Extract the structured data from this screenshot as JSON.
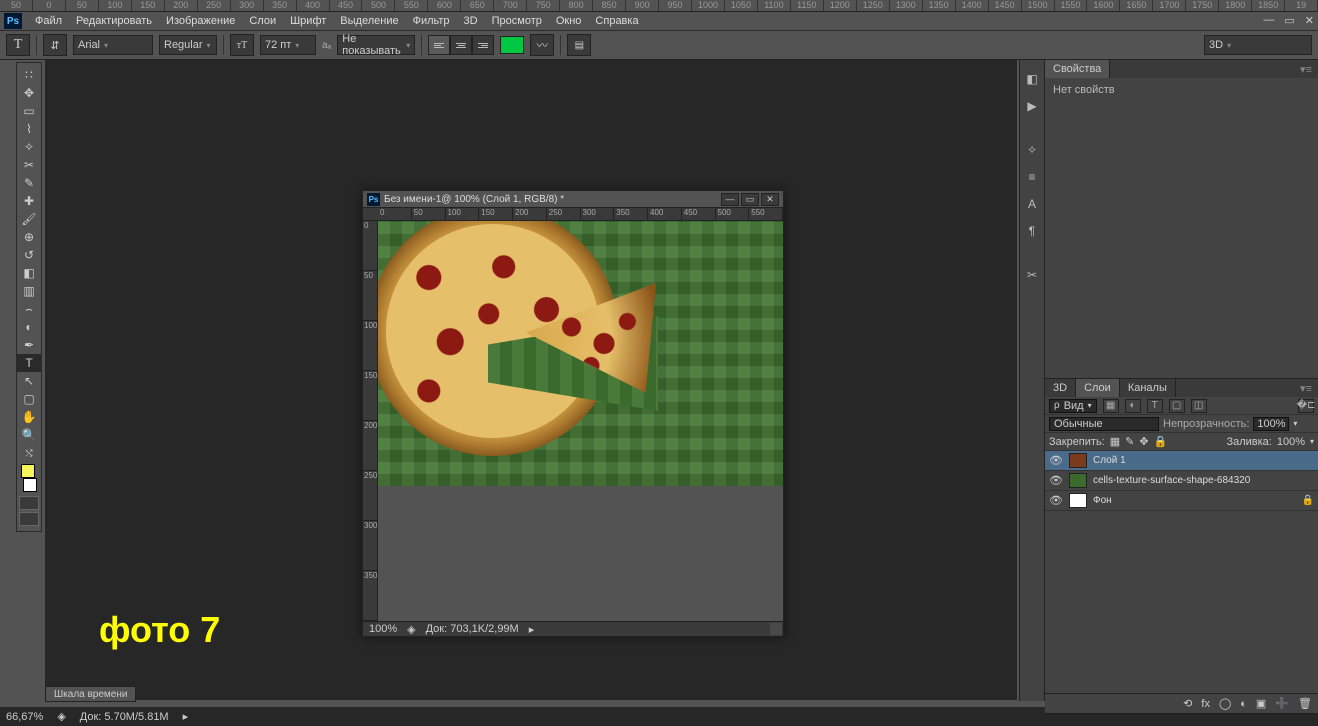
{
  "app": {
    "logo": "Ps"
  },
  "menu": [
    "Файл",
    "Редактировать",
    "Изображение",
    "Слои",
    "Шрифт",
    "Выделение",
    "Фильтр",
    "3D",
    "Просмотр",
    "Окно",
    "Справка"
  ],
  "ruler_top": [
    "50",
    "0",
    "50",
    "100",
    "150",
    "200",
    "250",
    "300",
    "350",
    "400",
    "450",
    "500",
    "550",
    "600",
    "650",
    "700",
    "750",
    "800",
    "850",
    "900",
    "950",
    "1000",
    "1050",
    "1100",
    "1150",
    "1200",
    "1250",
    "1300",
    "1350",
    "1400",
    "1450",
    "1500",
    "1550",
    "1600",
    "1650",
    "1700",
    "1750",
    "1800",
    "1850",
    "19"
  ],
  "options": {
    "tool_glyph": "T",
    "font": "Arial",
    "weight": "Regular",
    "size": "72 пт",
    "aa": "Не показывать",
    "color": "#00c843",
    "extra_dd": "3D"
  },
  "overlay_text": "фото 7",
  "document": {
    "title": "Без имени-1@ 100% (Слой 1, RGB/8) *",
    "hruler": [
      "0",
      "50",
      "100",
      "150",
      "200",
      "250",
      "300",
      "350",
      "400",
      "450",
      "500",
      "550"
    ],
    "vruler": [
      "0",
      "50",
      "100",
      "150",
      "200",
      "250",
      "300",
      "350"
    ],
    "zoom": "100%",
    "doc_size": "Док: 703,1K/2,99M"
  },
  "timeline_tab": "Шкала времени",
  "status": {
    "zoom": "66,67%",
    "doc": "Док: 5.70M/5.81M"
  },
  "props_panel": {
    "tab": "Свойства",
    "body": "Нет свойств"
  },
  "layers_panel": {
    "tabs": [
      "3D",
      "Слои",
      "Каналы"
    ],
    "kind_label": "Вид",
    "blend": "Обычные",
    "opacity_label": "Непрозрачность:",
    "opacity_value": "100%",
    "lock_label": "Закрепить:",
    "fill_label": "Заливка:",
    "fill_value": "100%",
    "layers": [
      {
        "name": "Слой 1",
        "selected": true,
        "thumb": "#7a3b1c"
      },
      {
        "name": "cells-texture-surface-shape-684320",
        "selected": false,
        "thumb": "#3b6a2d"
      },
      {
        "name": "Фон",
        "selected": false,
        "thumb": "#ffffff",
        "locked": true
      }
    ]
  }
}
